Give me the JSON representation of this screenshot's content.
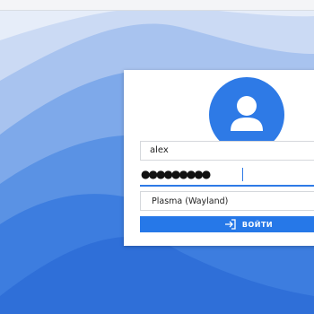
{
  "login": {
    "username": "alex",
    "password_masked": "●●●●●●●●●",
    "session": "Plasma (Wayland)",
    "login_button_label": "ВОЙТИ"
  },
  "icons": {
    "avatar": "user-avatar-icon",
    "login": "login-arrow-icon"
  },
  "colors": {
    "accent": "#2e7ae6",
    "button": "#2678e8",
    "card": "#ffffff",
    "wallpaper_dark": "#2f6fd8",
    "wallpaper_light": "#dfe8f7"
  }
}
